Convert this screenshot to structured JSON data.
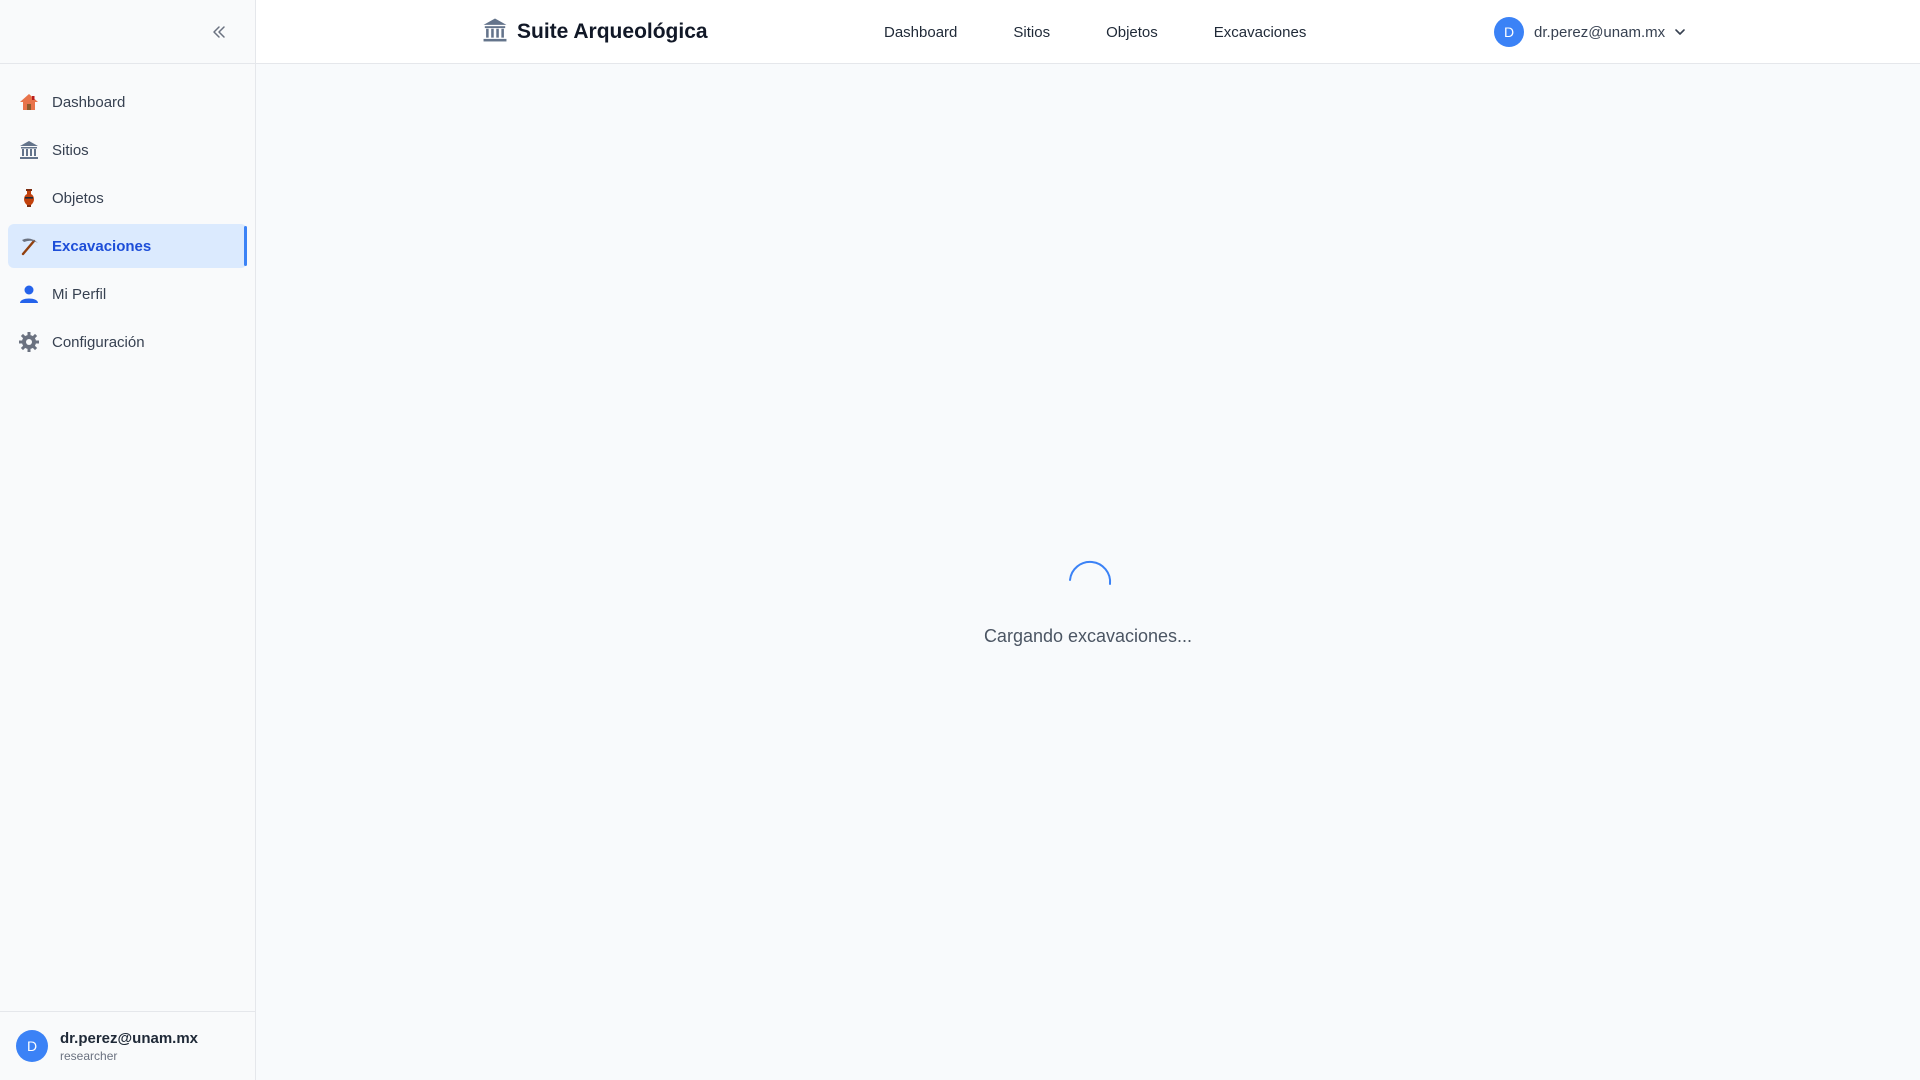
{
  "sidebar": {
    "collapse_icon": "double-chevron-left-icon",
    "items": [
      {
        "label": "Dashboard",
        "icon": "house-icon",
        "active": false
      },
      {
        "label": "Sitios",
        "icon": "classical-building-icon",
        "active": false
      },
      {
        "label": "Objetos",
        "icon": "amphora-icon",
        "active": false
      },
      {
        "label": "Excavaciones",
        "icon": "pick-icon",
        "active": true
      },
      {
        "label": "Mi Perfil",
        "icon": "user-icon",
        "active": false
      },
      {
        "label": "Configuración",
        "icon": "gear-icon",
        "active": false
      }
    ],
    "user": {
      "initial": "D",
      "email": "dr.perez@unam.mx",
      "role": "researcher"
    }
  },
  "header": {
    "logo_icon": "classical-building-icon",
    "title": "Suite Arqueológica",
    "nav": [
      "Dashboard",
      "Sitios",
      "Objetos",
      "Excavaciones"
    ],
    "user": {
      "initial": "D",
      "email": "dr.perez@unam.mx"
    }
  },
  "main": {
    "loading_text": "Cargando excavaciones..."
  },
  "colors": {
    "accent": "#3b82f6",
    "active_bg": "#dbeafe",
    "active_text": "#1d4ed8"
  }
}
